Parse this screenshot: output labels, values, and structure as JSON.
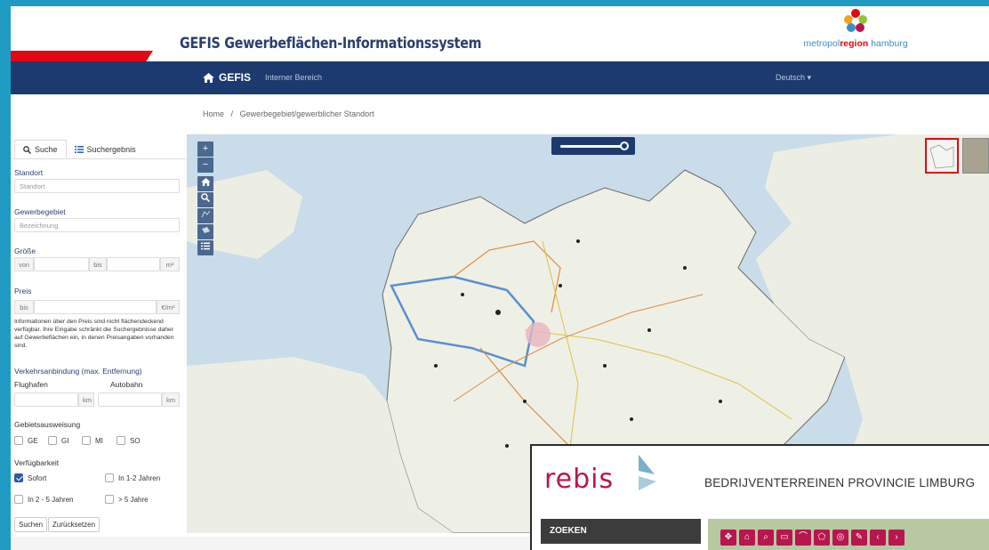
{
  "header": {
    "app_title": "GEFIS Gewerbeflächen-Informationssystem",
    "logo": {
      "text_a": "metropol",
      "text_b": "region",
      "text_c": " hamburg",
      "icon": "metropolregion-hamburg-logo"
    }
  },
  "navbar": {
    "home_label": "GEFIS",
    "home_icon": "home-icon",
    "internal_label": "Interner Bereich",
    "language_label": "Deutsch ▾"
  },
  "breadcrumb": {
    "home": "Home",
    "separator": "/",
    "current": "Gewerbegebiet/gewerblicher Standort"
  },
  "sidebar": {
    "tabs": [
      {
        "label": "Suche",
        "icon": "search-icon",
        "active": true
      },
      {
        "label": "Suchergebnis",
        "icon": "list-icon",
        "active": false
      }
    ],
    "standort": {
      "label": "Standort",
      "placeholder": "Standort"
    },
    "gewerbegebiet": {
      "label": "Gewerbegebiet",
      "placeholder": "Bezeichnung"
    },
    "groesse": {
      "label": "Größe",
      "from": "von",
      "to": "bis",
      "unit": "m²"
    },
    "preis": {
      "label": "Preis",
      "to": "bis",
      "unit": "€/m²",
      "info": "Informationen über den Preis sind nicht flächendeckend verfügbar. Ihre Eingabe schränkt die Suchergebnisse daher auf Gewerbeflächen ein, in denen Preisangaben vorhanden sind."
    },
    "verkehr": {
      "label": "Verkehrsanbindung (max. Entfernung)",
      "airport_label": "Flughafen",
      "highway_label": "Autobahn",
      "unit": "km"
    },
    "gebiet": {
      "label": "Gebietsausweisung",
      "options": [
        "GE",
        "GI",
        "MI",
        "SO"
      ]
    },
    "verfuegbarkeit": {
      "label": "Verfügbarkeit",
      "options": [
        "Sofort",
        "In 1-2 Jahren",
        "In 2 - 5 Jahren",
        "> 5 Jahre"
      ],
      "checked": "Sofort"
    },
    "buttons": {
      "search": "Suchen",
      "reset": "Zurücksetzen"
    }
  },
  "map": {
    "controls": [
      "zoom-in-icon",
      "zoom-out-icon",
      "home-icon",
      "search-icon",
      "measure-line-icon",
      "measure-area-icon",
      "legend-icon"
    ],
    "zoom_in": "+",
    "zoom_out": "−",
    "opacity_level": 0.92
  },
  "rebis": {
    "logo_text": "rebis",
    "title": "BEDRIJVENTERREINEN PROVINCIE LIMBURG",
    "search_label": "ZOEKEN",
    "colors": {
      "brand": "#b7164f",
      "flag": "#7ab0c8"
    }
  },
  "colors": {
    "navy": "#1c3a6e",
    "accent_red": "#e30613",
    "frame_bg": "#1f9cc4",
    "map_water": "#c9dcea"
  }
}
